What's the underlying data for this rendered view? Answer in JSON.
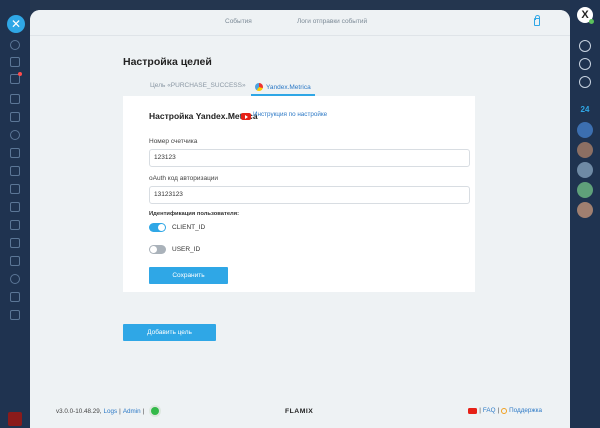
{
  "top_tabs": [
    "События",
    "Логи отправки событий"
  ],
  "page_title": "Настройка целей",
  "sub_tabs": [
    "Цель «PURCHASE_SUCCESS»",
    "Yandex.Metrica"
  ],
  "card": {
    "title": "Настройка Yandex.Metrica",
    "instruction_link": "Инструкция по настройке",
    "counter_label": "Номер счетчика",
    "counter_value": "123123",
    "oauth_label": "oAuth код авторизации",
    "oauth_value": "13123123",
    "ident_label": "Идентификация пользователя:",
    "toggles": [
      {
        "label": "CLIENT_ID",
        "on": true
      },
      {
        "label": "USER_ID",
        "on": false
      }
    ],
    "save_label": "Сохранить"
  },
  "add_goal_label": "Добавить цель",
  "footer": {
    "version": "v3.0.0-10.48.29,",
    "logs": "Logs",
    "sep1": "|",
    "admin": "Admin",
    "sep2": "|",
    "logo": "FLAMIX",
    "faq": "FAQ",
    "support": "Поддержка",
    "sep3": "|",
    "sep4": "|"
  },
  "right_rail": {
    "day_number": "24"
  },
  "colors": {
    "accent": "#2fa7e6",
    "status_ok": "#33b949",
    "youtube": "#e62117"
  }
}
